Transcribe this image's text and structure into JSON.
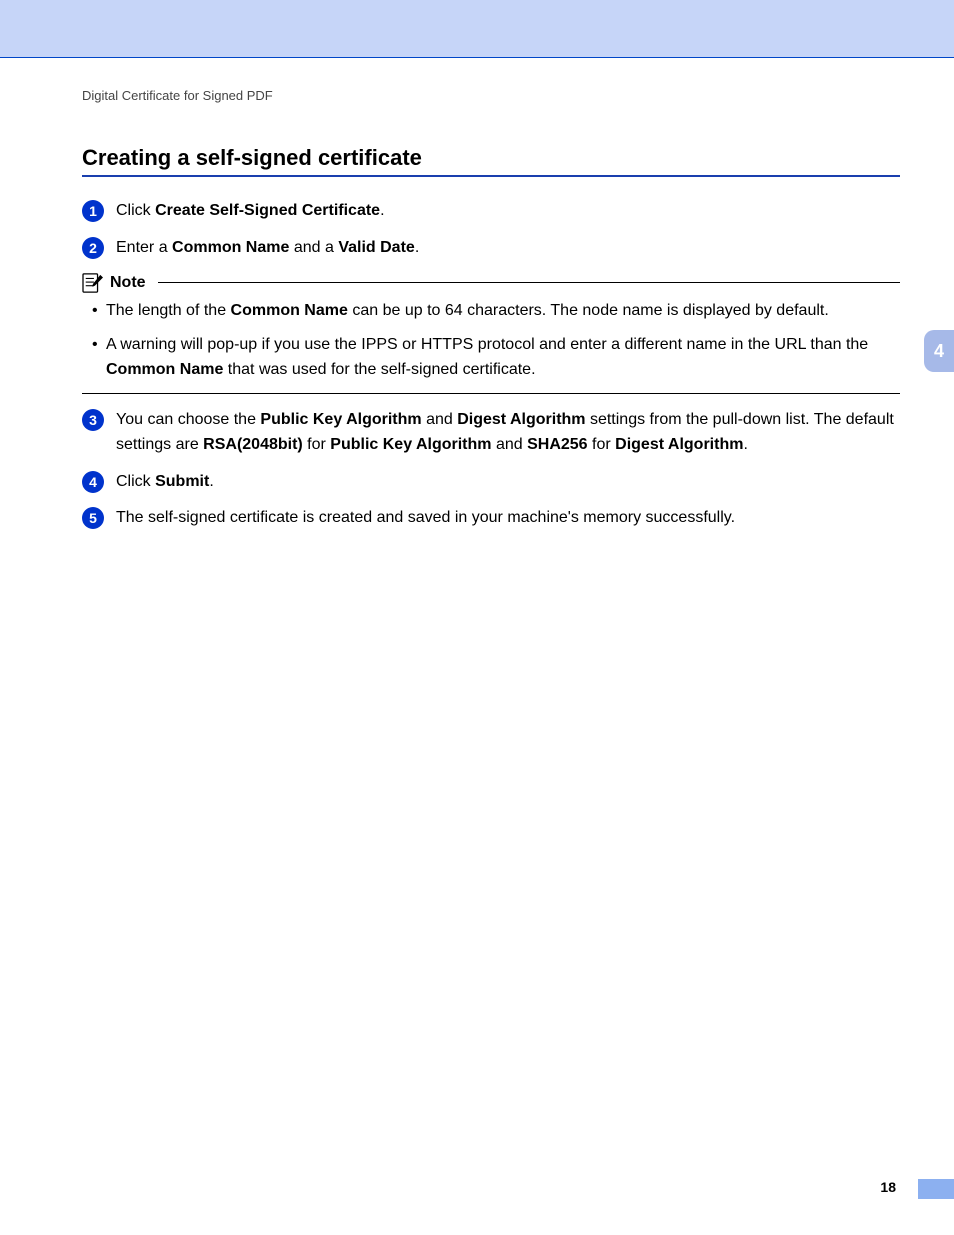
{
  "breadcrumb": "Digital Certificate for Signed PDF",
  "heading": "Creating a self-signed certificate",
  "steps": {
    "s1": {
      "num": "1",
      "pre": "Click ",
      "b1": "Create Self-Signed Certificate",
      "post": "."
    },
    "s2": {
      "num": "2",
      "pre": "Enter a ",
      "b1": "Common Name",
      "mid": " and a ",
      "b2": "Valid Date",
      "post": "."
    },
    "s3": {
      "num": "3",
      "t0": "You can choose the ",
      "b1": "Public Key Algorithm",
      "t1": " and ",
      "b2": "Digest Algorithm",
      "t2": " settings from the pull-down list. The default settings are ",
      "b3": "RSA(2048bit)",
      "t3": " for ",
      "b4": "Public Key Algorithm",
      "t4": " and ",
      "b5": "SHA256",
      "t5": " for ",
      "b6": "Digest Algorithm",
      "t6": "."
    },
    "s4": {
      "num": "4",
      "pre": "Click ",
      "b1": "Submit",
      "post": "."
    },
    "s5": {
      "num": "5",
      "text": "The self-signed certificate is created and saved in your machine's memory successfully."
    }
  },
  "note": {
    "label": "Note",
    "items": {
      "n1": {
        "t0": "The length of the ",
        "b1": "Common Name",
        "t1": " can be up to 64 characters. The node name is displayed by default."
      },
      "n2": {
        "t0": "A warning will pop-up if you use the IPPS or HTTPS protocol and enter a different name in the URL than the ",
        "b1": "Common Name",
        "t1": " that was used for the self-signed certificate."
      }
    }
  },
  "sideTab": "4",
  "pageNumber": "18"
}
